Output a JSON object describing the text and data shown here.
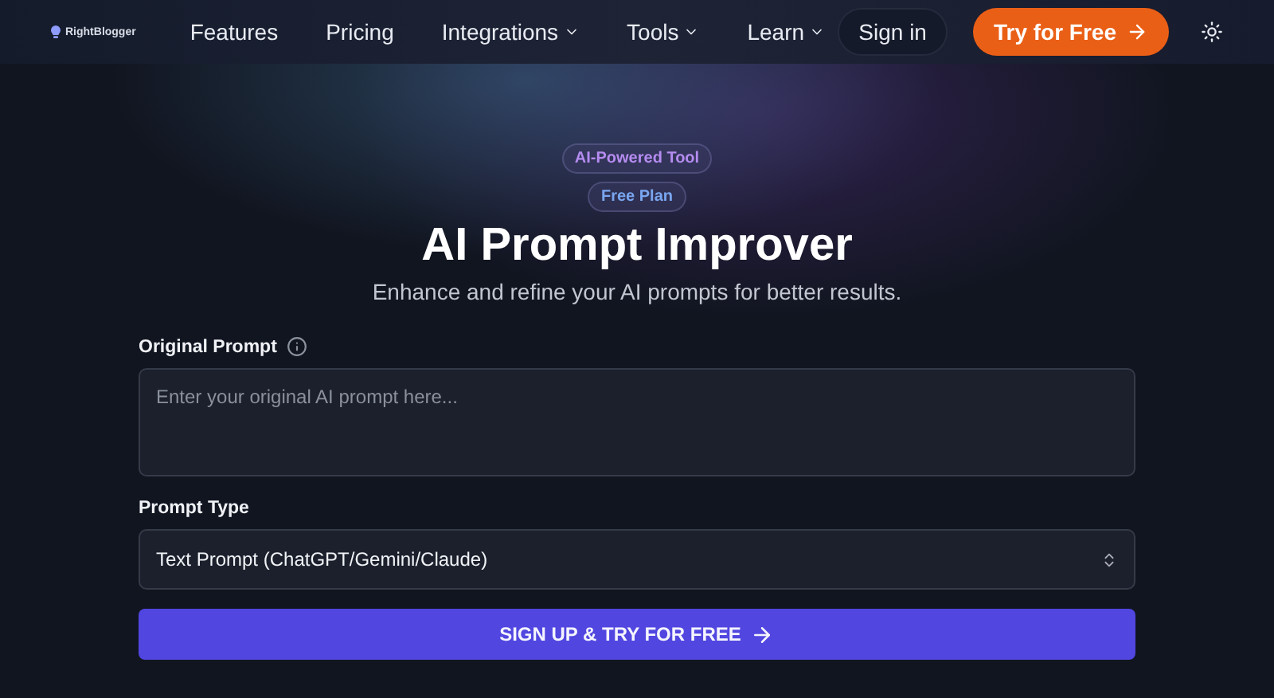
{
  "header": {
    "logo": "RightBlogger",
    "nav": [
      {
        "label": "Features",
        "has_menu": false
      },
      {
        "label": "Pricing",
        "has_menu": false
      },
      {
        "label": "Integrations",
        "has_menu": true
      },
      {
        "label": "Tools",
        "has_menu": true
      },
      {
        "label": "Learn",
        "has_menu": true
      }
    ],
    "sign_in": "Sign in",
    "cta": "Try for Free"
  },
  "badges": [
    {
      "label": "AI-Powered Tool",
      "color": "#b58cf0"
    },
    {
      "label": "Free Plan",
      "color": "#7aa6f0"
    }
  ],
  "title": "AI Prompt Improver",
  "subtitle": "Enhance and refine your AI prompts for better results.",
  "form": {
    "prompt_label": "Original Prompt",
    "prompt_placeholder": "Enter your original AI prompt here...",
    "type_label": "Prompt Type",
    "type_value": "Text Prompt (ChatGPT/Gemini/Claude)",
    "submit": "SIGN UP & TRY FOR FREE"
  }
}
